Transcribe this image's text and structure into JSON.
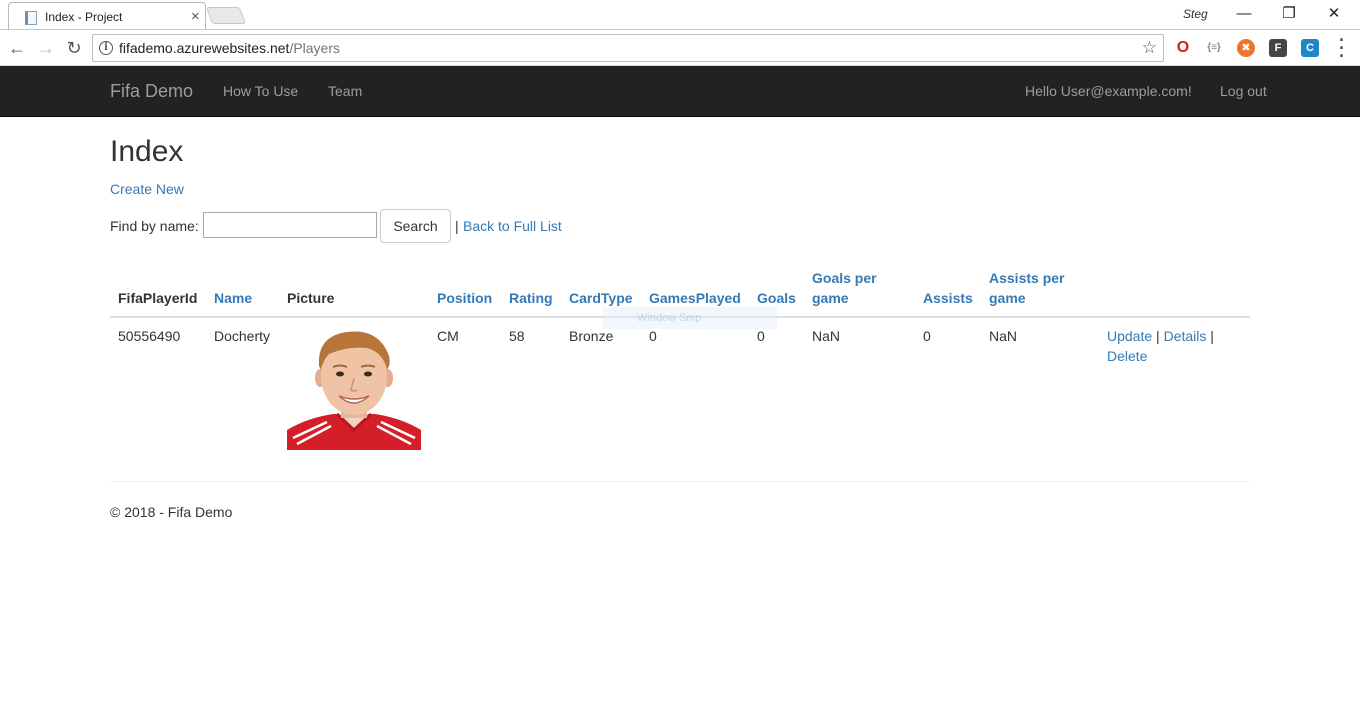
{
  "browser": {
    "tab_title": "Index - Project",
    "profile_name": "Steg",
    "url_host": "fifademo.azurewebsites.net",
    "url_path": "/Players"
  },
  "navbar": {
    "brand": "Fifa Demo",
    "links": [
      "How To Use",
      "Team"
    ],
    "greeting": "Hello User@example.com!",
    "logout": "Log out"
  },
  "page": {
    "title": "Index",
    "create_new": "Create New",
    "find_label": "Find by name:",
    "search_value": "",
    "search_button": "Search",
    "separator": "|",
    "back_link": "Back to Full List"
  },
  "table": {
    "headers": [
      "FifaPlayerId",
      "Name",
      "Picture",
      "Position",
      "Rating",
      "CardType",
      "GamesPlayed",
      "Goals",
      "Goals per game",
      "Assists",
      "Assists per game"
    ],
    "rows": [
      {
        "id": "50556490",
        "name": "Docherty",
        "position": "CM",
        "rating": "58",
        "card_type": "Bronze",
        "games_played": "0",
        "goals": "0",
        "goals_per_game": "NaN",
        "assists": "0",
        "assists_per_game": "NaN",
        "actions": {
          "update": "Update",
          "details": "Details",
          "delete": "Delete",
          "sep": "|"
        }
      }
    ]
  },
  "overlay": {
    "snip_text": "Window Snip"
  },
  "footer": {
    "text": "© 2018 - Fifa Demo"
  },
  "colors": {
    "link": "#337ab7",
    "navbar_bg": "#222222",
    "navbar_text": "#9d9d9d"
  }
}
